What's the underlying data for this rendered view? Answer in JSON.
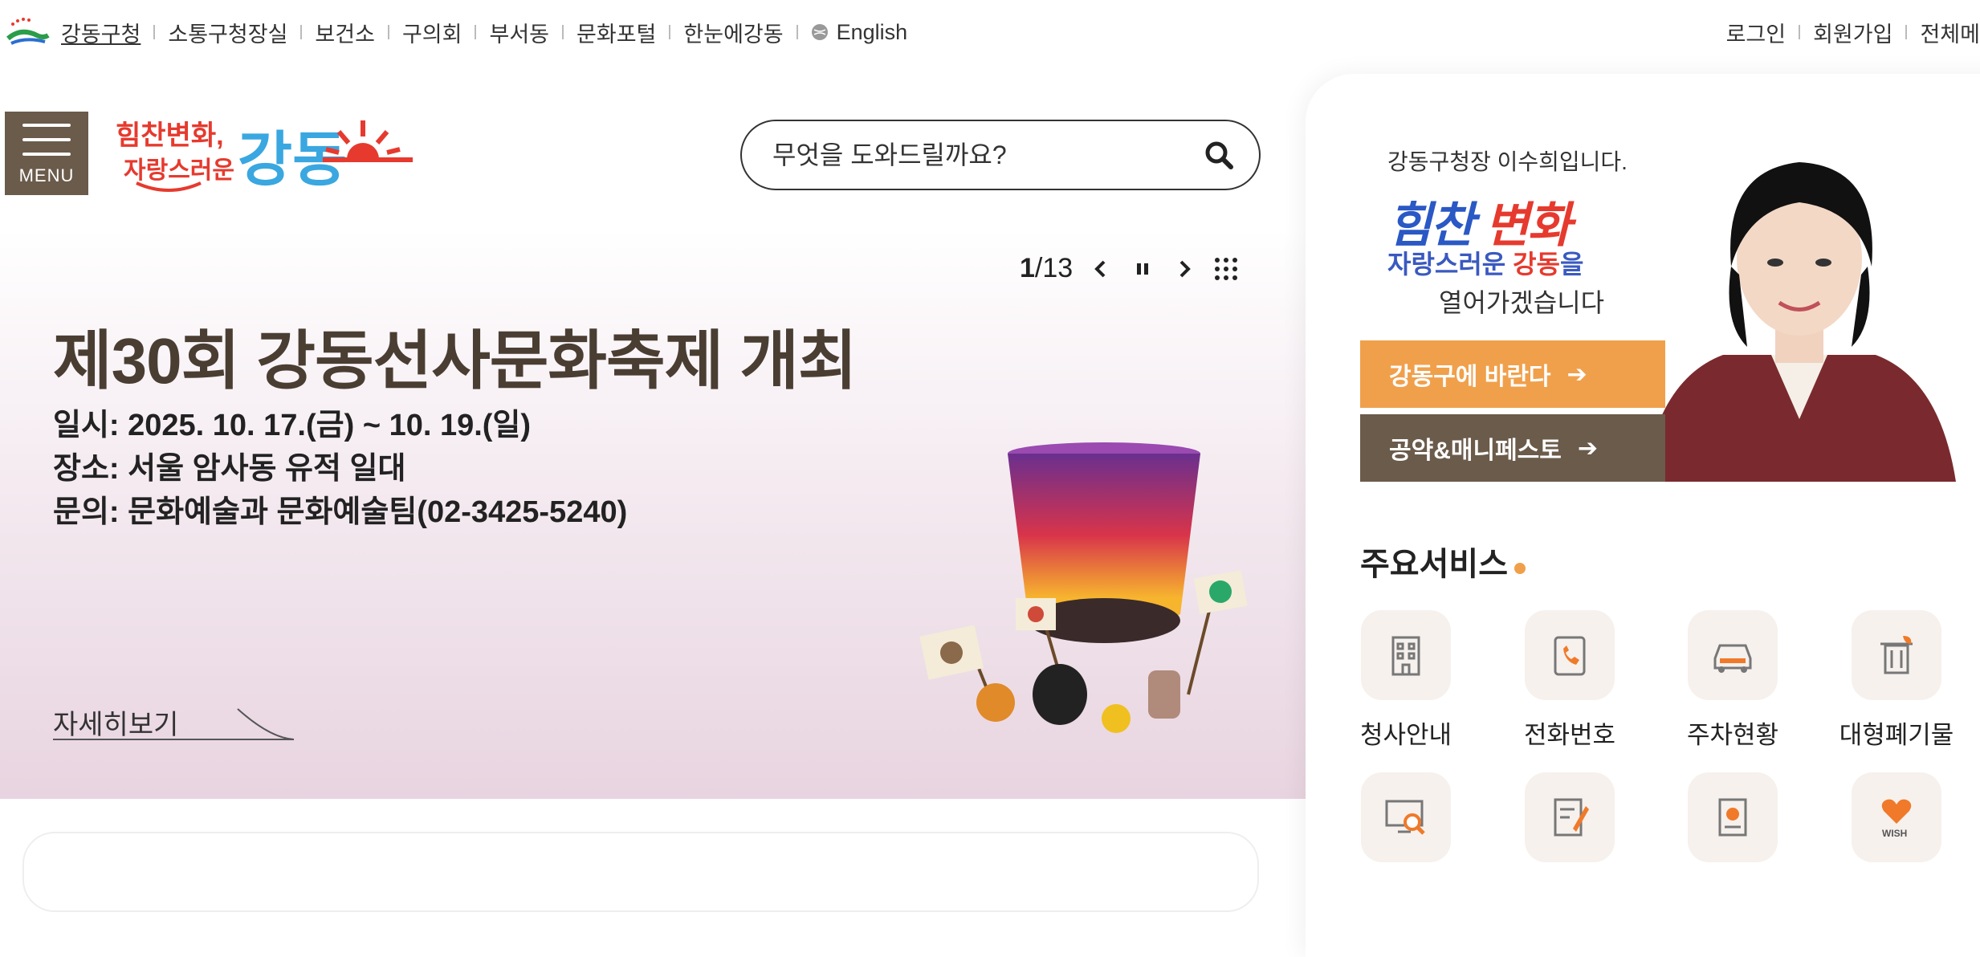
{
  "topbar": {
    "links": [
      "강동구청",
      "소통구청장실",
      "보건소",
      "구의회",
      "부서동",
      "문화포털",
      "한눈에강동"
    ],
    "english": "English",
    "login": "로그인",
    "signup": "회원가입",
    "allmenu": "전체메"
  },
  "header": {
    "menu_label": "MENU",
    "logo_line1": "힘찬변화,",
    "logo_line2": "자랑스러운",
    "logo_main": "강동",
    "search_placeholder": "무엇을 도와드릴까요?"
  },
  "slider": {
    "current": "1",
    "total": "13",
    "title": "제30회 강동선사문화축제 개최",
    "lines": [
      "일시: 2025. 10. 17.(금) ~ 10. 19.(일)",
      "장소: 서울 암사동 유적 일대",
      "문의: 문화예술과 문화예술팀(02-3425-5240)"
    ],
    "detail_label": "자세히보기"
  },
  "mayor": {
    "greeting": "강동구청장 이수희입니다.",
    "slogan_blue": "힘찬",
    "slogan_red": "변화",
    "slogan_line2_a": "자랑스러운 ",
    "slogan_line2_b": "강동",
    "slogan_line2_c": "을",
    "slogan_line3": "열어가겠습니다",
    "cta1": "강동구에 바란다",
    "cta2": "공약&매니페스토"
  },
  "services": {
    "title": "주요서비스",
    "items": [
      {
        "label": "청사안내",
        "icon": "building-icon"
      },
      {
        "label": "전화번호",
        "icon": "phone-book-icon"
      },
      {
        "label": "주차현황",
        "icon": "car-icon"
      },
      {
        "label": "대형폐기물",
        "icon": "trash-icon"
      },
      {
        "label": "",
        "icon": "monitor-search-icon"
      },
      {
        "label": "",
        "icon": "edit-form-icon"
      },
      {
        "label": "",
        "icon": "document-globe-icon"
      },
      {
        "label": "WISH",
        "icon": "wish-heart-icon"
      }
    ]
  },
  "colors": {
    "brown": "#6b5b4b",
    "orange": "#f0a04b",
    "slogan_blue": "#2a58c4",
    "slogan_red": "#e63a2e"
  }
}
